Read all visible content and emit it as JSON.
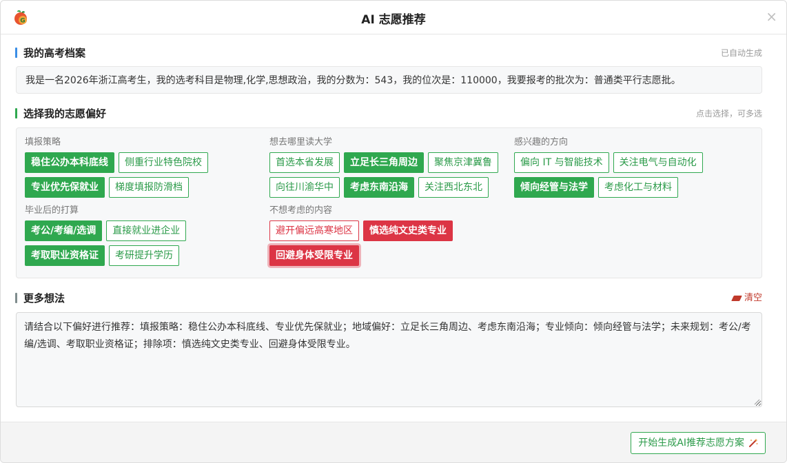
{
  "dialog": {
    "title": "AI 志愿推荐",
    "close_glyph": "×"
  },
  "profile": {
    "heading": "我的高考档案",
    "hint": "已自动生成",
    "text": "我是一名2026年浙江高考生，我的选考科目是物理,化学,思想政治，我的分数为：543，我的位次是：110000，我要报考的批次为：普通类平行志愿批。"
  },
  "preferences": {
    "heading": "选择我的志愿偏好",
    "hint": "点击选择，可多选",
    "groups": [
      {
        "label": "填报策略",
        "rows": [
          [
            {
              "label": "稳住公办本科底线",
              "selected": true
            },
            {
              "label": "侧重行业特色院校",
              "selected": false
            }
          ],
          [
            {
              "label": "专业优先保就业",
              "selected": true
            },
            {
              "label": "梯度填报防滑档",
              "selected": false
            }
          ]
        ]
      },
      {
        "label": "想去哪里读大学",
        "rows": [
          [
            {
              "label": "首选本省发展",
              "selected": false
            },
            {
              "label": "立足长三角周边",
              "selected": true
            },
            {
              "label": "聚焦京津冀鲁",
              "selected": false
            }
          ],
          [
            {
              "label": "向往川渝华中",
              "selected": false
            },
            {
              "label": "考虑东南沿海",
              "selected": true
            },
            {
              "label": "关注西北东北",
              "selected": false
            }
          ]
        ]
      },
      {
        "label": "感兴趣的方向",
        "rows": [
          [
            {
              "label": "偏向 IT 与智能技术",
              "selected": false
            },
            {
              "label": "关注电气与自动化",
              "selected": false
            }
          ],
          [
            {
              "label": "倾向经管与法学",
              "selected": true
            },
            {
              "label": "考虑化工与材料",
              "selected": false
            }
          ]
        ]
      },
      {
        "label": "毕业后的打算",
        "rows": [
          [
            {
              "label": "考公/考编/选调",
              "selected": true
            },
            {
              "label": "直接就业进企业",
              "selected": false
            }
          ],
          [
            {
              "label": "考取职业资格证",
              "selected": true
            },
            {
              "label": "考研提升学历",
              "selected": false
            }
          ]
        ]
      },
      {
        "label": "不想考虑的内容",
        "rows": [
          [
            {
              "label": "避开偏远高寒地区",
              "selected": false
            },
            {
              "label": "慎选纯文史类专业",
              "selected": true
            }
          ],
          [
            {
              "label": "回避身体受限专业",
              "selected": true
            }
          ]
        ]
      }
    ]
  },
  "more": {
    "heading": "更多想法",
    "clear_label": "清空",
    "text": "请结合以下偏好进行推荐：填报策略：稳住公办本科底线、专业优先保就业；地域偏好：立足长三角周边、考虑东南沿海；专业倾向：倾向经管与法学；未来规划：考公/考编/选调、考取职业资格证；排除项：慎选纯文史类专业、回避身体受限专业。"
  },
  "footer": {
    "generate_label": "开始生成AI推荐志愿方案"
  },
  "colors": {
    "accent": "#2fa84f",
    "danger": "#dc3545",
    "bar_blue": "#3a8ee6",
    "bar_green": "#2fa84f",
    "bar_gray": "#7f8c8d"
  },
  "icons": {
    "logo": "app-logo-icon",
    "close": "close-icon",
    "eraser": "eraser-icon",
    "wand": "magic-wand-icon"
  }
}
